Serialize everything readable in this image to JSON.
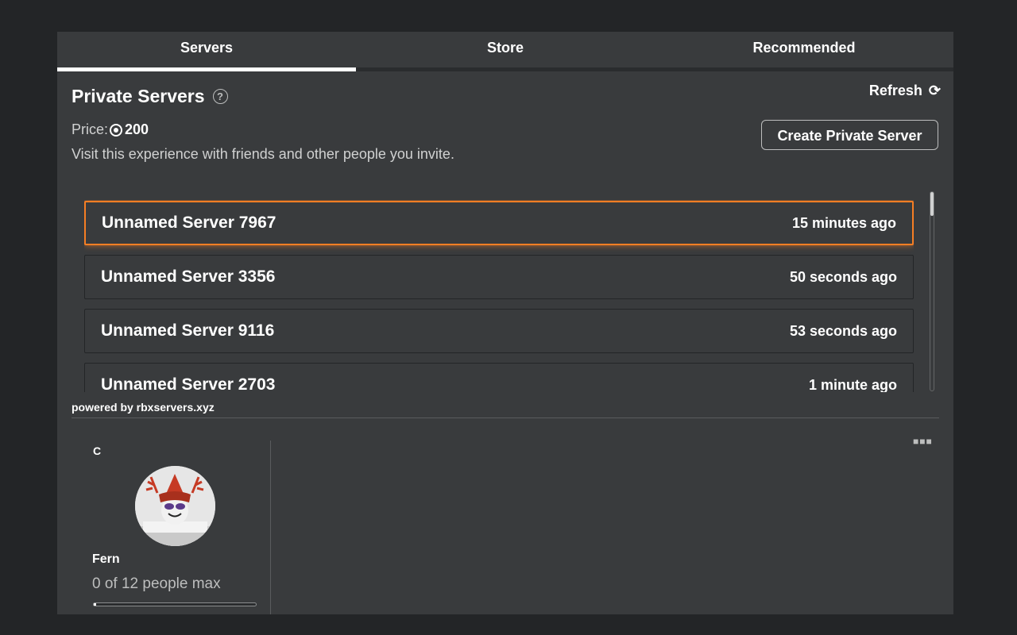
{
  "tabs": [
    {
      "label": "Servers",
      "active": true
    },
    {
      "label": "Store",
      "active": false
    },
    {
      "label": "Recommended",
      "active": false
    }
  ],
  "header": {
    "title": "Private Servers",
    "help_icon": "question-circle-icon",
    "refresh_label": "Refresh",
    "refresh_icon": "refresh-icon"
  },
  "price": {
    "label": "Price:",
    "currency_icon": "robux-icon",
    "value": "200"
  },
  "description": "Visit this experience with friends and other people you invite.",
  "create_button": "Create Private Server",
  "servers": [
    {
      "name": "Unnamed Server 7967",
      "time": "15 minutes ago",
      "selected": true
    },
    {
      "name": "Unnamed Server 3356",
      "time": "50 seconds ago",
      "selected": false
    },
    {
      "name": "Unnamed Server 9116",
      "time": "53 seconds ago",
      "selected": false
    },
    {
      "name": "Unnamed Server 2703",
      "time": "1 minute ago",
      "selected": false
    }
  ],
  "powered_by": "powered by rbxservers.xyz",
  "card": {
    "letter": "C",
    "name": "Fern",
    "players_text": "0 of 12 people max",
    "players_current": 0,
    "players_max": 12,
    "more_icon": "more-options-icon"
  },
  "colors": {
    "background": "#232527",
    "panel": "#393b3d",
    "accent": "#f67e24",
    "text": "#ffffff",
    "muted_text": "#bdbebe"
  }
}
